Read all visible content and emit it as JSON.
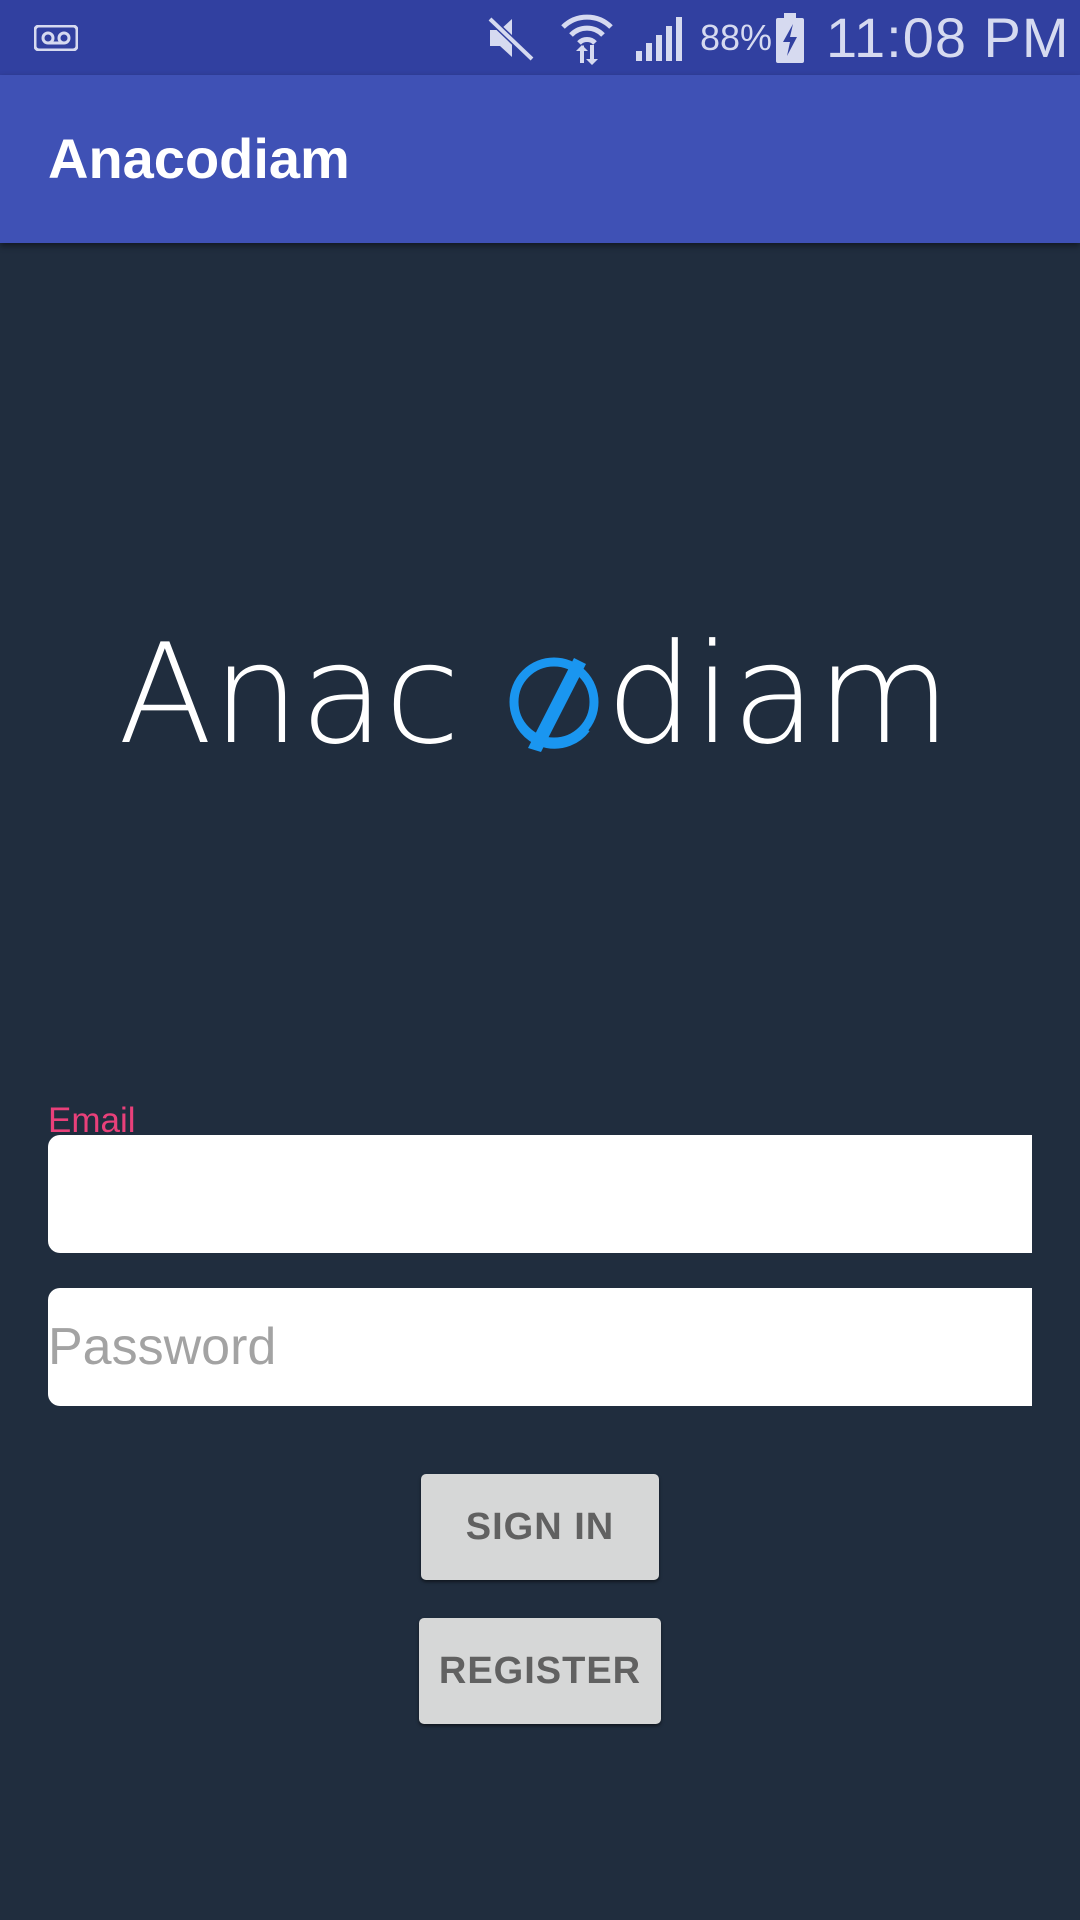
{
  "status_bar": {
    "battery_percent": "88%",
    "time": "11:08 PM",
    "icons": [
      "voicemail-icon",
      "mute-icon",
      "wifi-icon",
      "signal-icon",
      "battery-charging-icon"
    ]
  },
  "app_bar": {
    "title": "Anacodiam"
  },
  "logo": {
    "text_before": "Anac",
    "text_after": "diam",
    "accent_color": "#1a96f0"
  },
  "login_form": {
    "email_label": "Email",
    "email_value": "",
    "password_placeholder": "Password",
    "password_value": "",
    "sign_in_label": "SIGN IN",
    "register_label": "REGISTER"
  },
  "colors": {
    "status_bar": "#3140a0",
    "app_bar": "#3f51b5",
    "background": "#202d3e",
    "label_accent": "#e9407a",
    "button_bg": "#d6d7d7",
    "button_text": "#616161"
  }
}
